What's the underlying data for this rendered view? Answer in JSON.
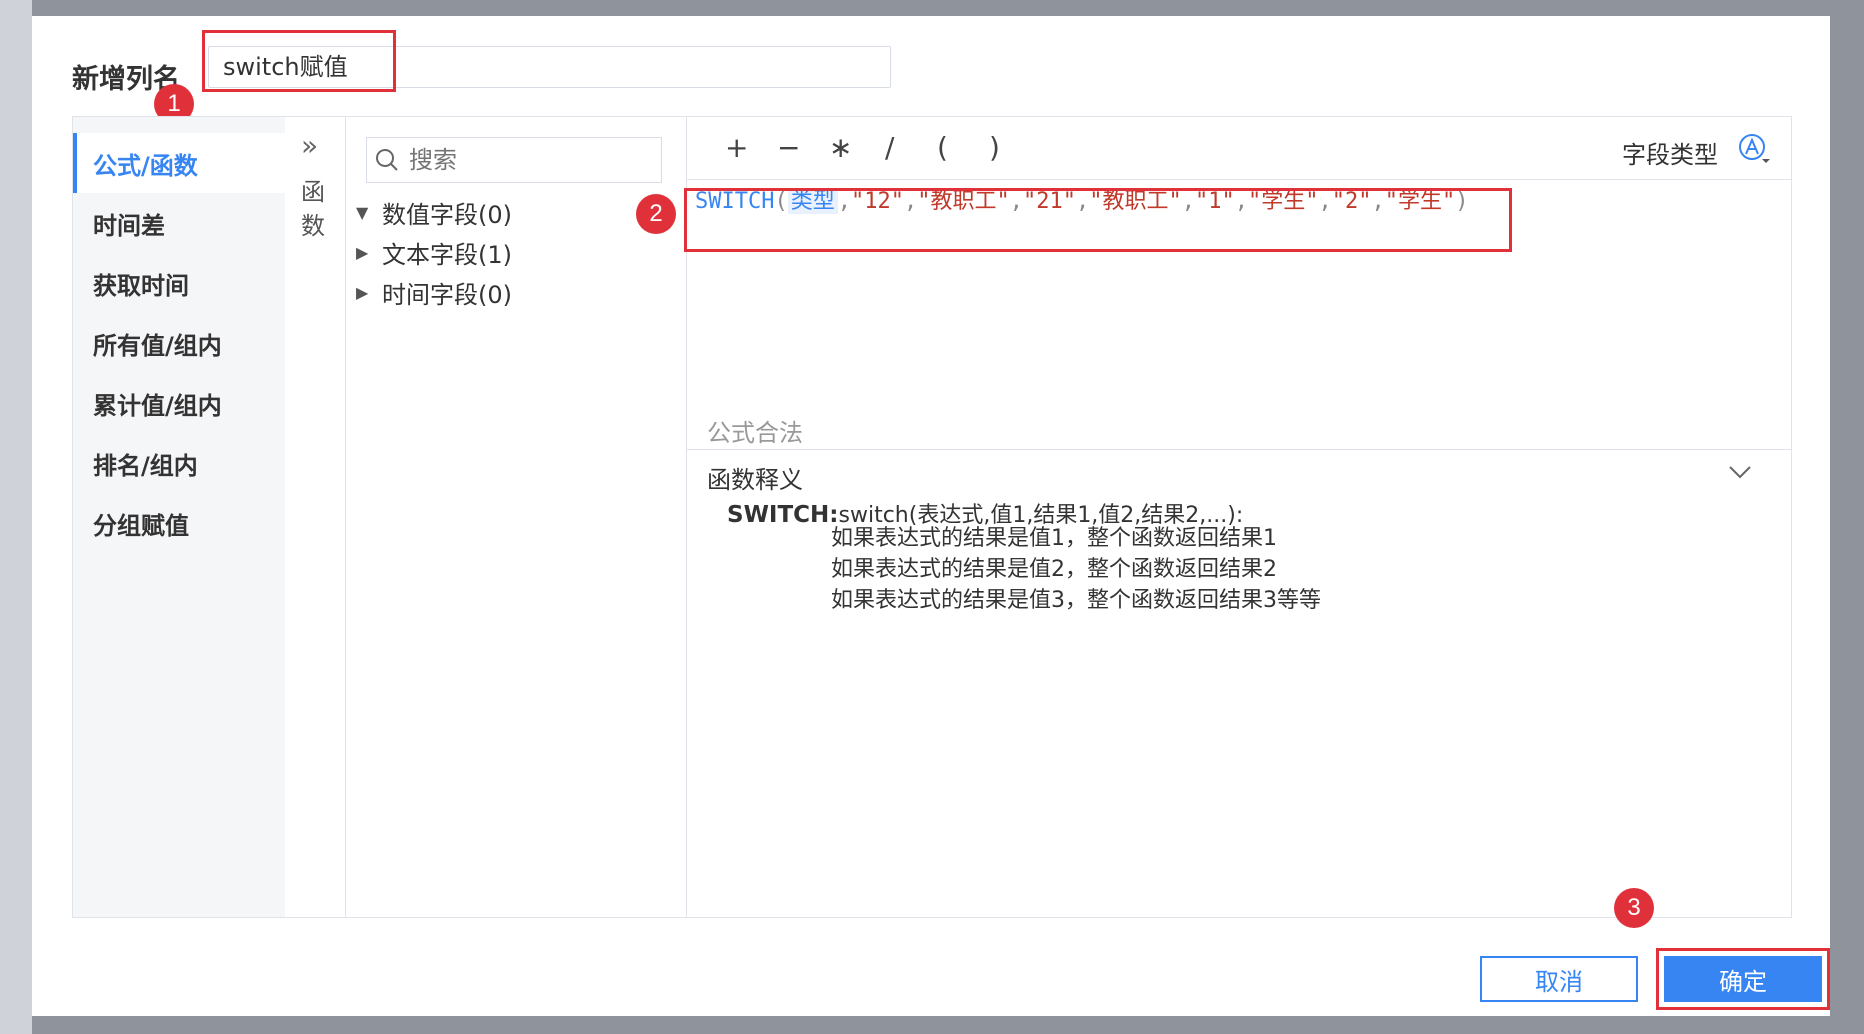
{
  "dialog": {
    "title": "新增列名",
    "column_name": "switch赋值"
  },
  "left_nav": {
    "items": [
      {
        "label": "公式/函数",
        "active": true
      },
      {
        "label": "时间差",
        "active": false
      },
      {
        "label": "获取时间",
        "active": false
      },
      {
        "label": "所有值/组内",
        "active": false
      },
      {
        "label": "累计值/组内",
        "active": false
      },
      {
        "label": "排名/组内",
        "active": false
      },
      {
        "label": "分组赋值",
        "active": false
      }
    ]
  },
  "func_strip": {
    "chevron": "»",
    "label_line1": "函",
    "label_line2": "数"
  },
  "field_panel": {
    "search_placeholder": "搜索",
    "groups": [
      {
        "label": "数值字段(0)",
        "expanded": true
      },
      {
        "label": "文本字段(1)",
        "expanded": false
      },
      {
        "label": "时间字段(0)",
        "expanded": false
      }
    ]
  },
  "toolbar": {
    "operators": [
      "+",
      "−",
      "∗",
      "/",
      "(",
      ")"
    ],
    "field_type_label": "字段类型",
    "field_type_icon": "text-type-icon"
  },
  "formula": {
    "func": "SWITCH",
    "open": "(",
    "field": "类型",
    "args": [
      ",",
      "\"12\"",
      ",",
      "\"教职工\"",
      ",",
      "\"21\"",
      ",",
      "\"教职工\"",
      ",",
      "\"1\"",
      ",",
      "\"学生\"",
      ",",
      "\"2\"",
      ",",
      "\"学生\""
    ],
    "close": ")"
  },
  "status": {
    "legal": "公式合法"
  },
  "description": {
    "title": "函数释义",
    "name": "SWITCH:",
    "signature": "switch(表达式,值1,结果1,值2,结果2,...):",
    "line1": "如果表达式的结果是值1，整个函数返回结果1",
    "line2": "如果表达式的结果是值2，整个函数返回结果2",
    "line3": "如果表达式的结果是值3，整个函数返回结果3等等"
  },
  "footer": {
    "cancel_label": "取消",
    "ok_label": "确定"
  },
  "annotations": {
    "badge1": "1",
    "badge2": "2",
    "badge3": "3"
  },
  "colors": {
    "accent": "#3685f2",
    "highlight": "#e0313a"
  }
}
